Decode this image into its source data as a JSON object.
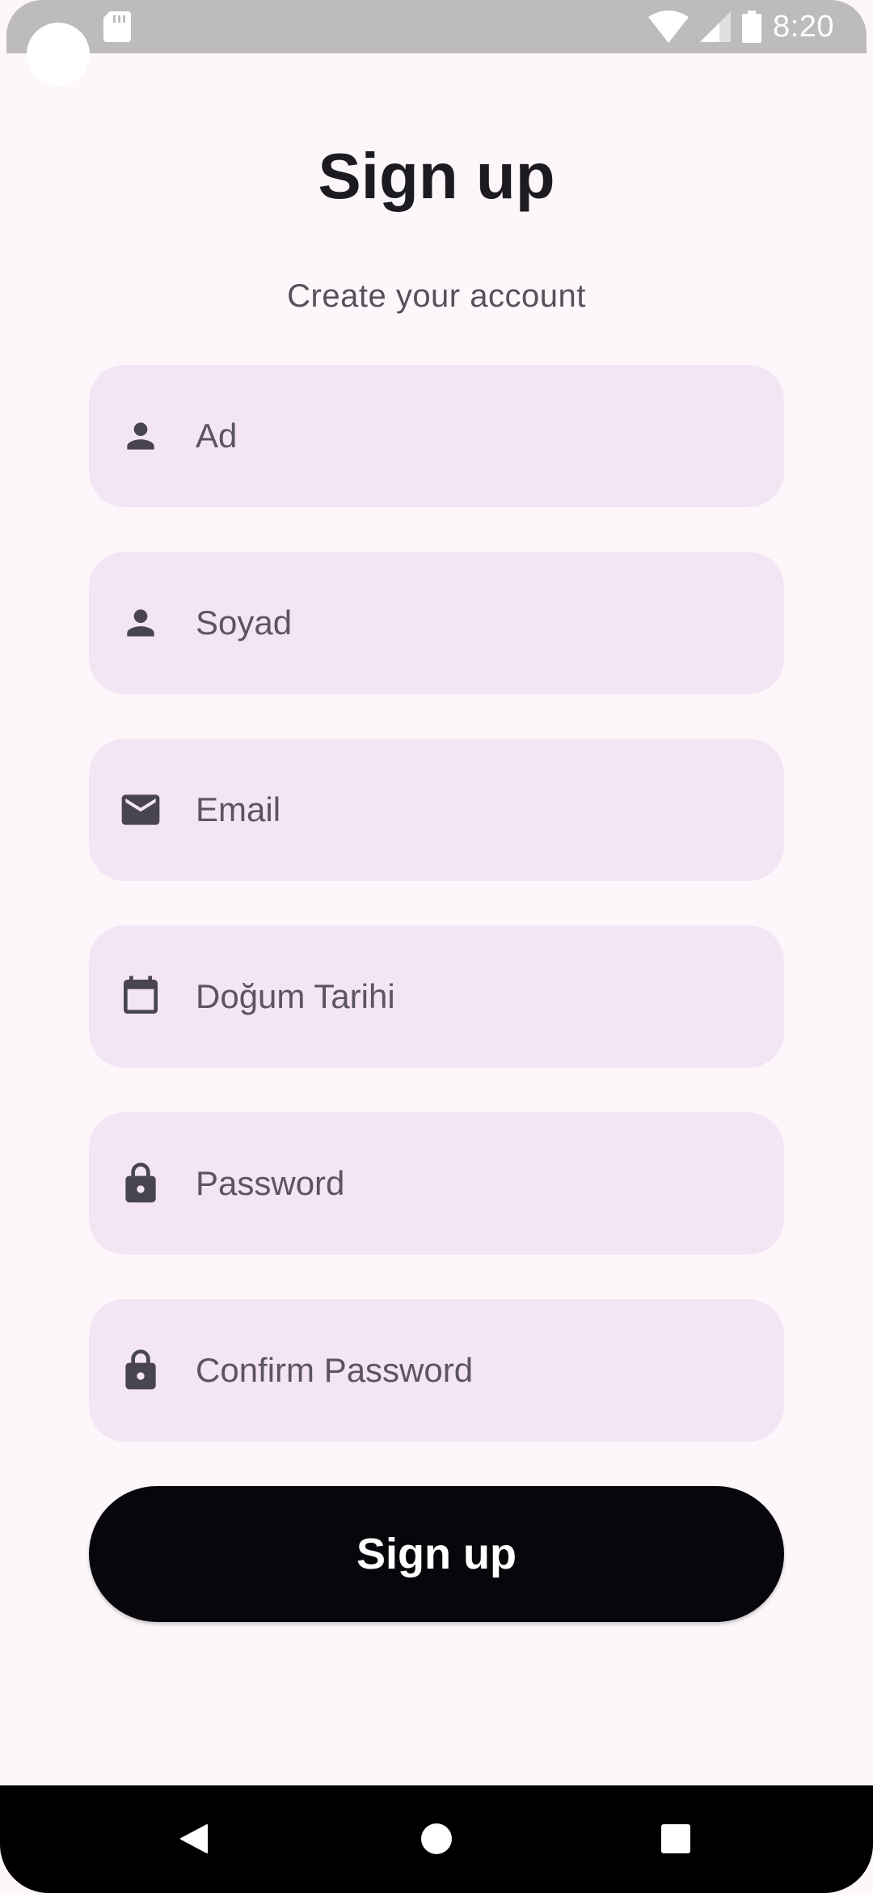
{
  "status_bar": {
    "time": "8:20",
    "icons": [
      "sd-card-icon",
      "wifi-icon",
      "cellular-icon",
      "battery-icon"
    ]
  },
  "header": {
    "title": "Sign up",
    "subtitle": "Create your account"
  },
  "form": {
    "fields": [
      {
        "icon": "person-icon",
        "placeholder": "Ad",
        "value": ""
      },
      {
        "icon": "person-icon",
        "placeholder": "Soyad",
        "value": ""
      },
      {
        "icon": "email-icon",
        "placeholder": "Email",
        "value": ""
      },
      {
        "icon": "calendar-icon",
        "placeholder": "Doğum Tarihi",
        "value": ""
      },
      {
        "icon": "lock-icon",
        "placeholder": "Password",
        "value": ""
      },
      {
        "icon": "lock-icon",
        "placeholder": "Confirm Password",
        "value": ""
      }
    ],
    "submit_label": "Sign up"
  },
  "nav_bar": {
    "buttons": [
      "back-icon",
      "home-icon",
      "recents-icon"
    ]
  },
  "colors": {
    "background": "#fdf7fb",
    "field_background": "#f4e5f4",
    "button_background": "#07060a",
    "status_bar": "#bdbbbd",
    "icon": "#49454f"
  }
}
